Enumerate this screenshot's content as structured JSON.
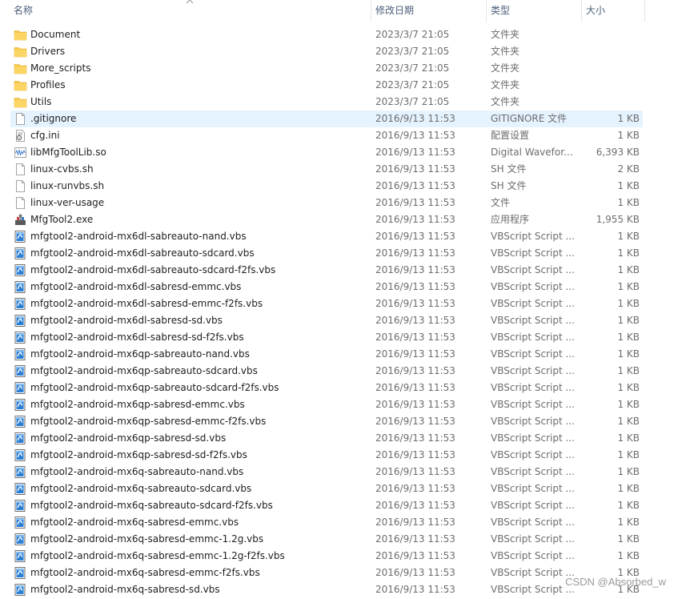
{
  "header": {
    "name": "名称",
    "date": "修改日期",
    "type": "类型",
    "size": "大小"
  },
  "rows": [
    {
      "icon": "folder-icon",
      "name": "Document",
      "date": "2023/3/7 21:05",
      "type": "文件夹",
      "size": ""
    },
    {
      "icon": "folder-icon",
      "name": "Drivers",
      "date": "2023/3/7 21:05",
      "type": "文件夹",
      "size": ""
    },
    {
      "icon": "folder-icon",
      "name": "More_scripts",
      "date": "2023/3/7 21:05",
      "type": "文件夹",
      "size": ""
    },
    {
      "icon": "folder-icon",
      "name": "Profiles",
      "date": "2023/3/7 21:05",
      "type": "文件夹",
      "size": ""
    },
    {
      "icon": "folder-icon",
      "name": "Utils",
      "date": "2023/3/7 21:05",
      "type": "文件夹",
      "size": ""
    },
    {
      "icon": "file-icon",
      "name": ".gitignore",
      "date": "2016/9/13 11:53",
      "type": "GITIGNORE 文件",
      "size": "1 KB",
      "selected": true
    },
    {
      "icon": "config-file-icon",
      "name": "cfg.ini",
      "date": "2016/9/13 11:53",
      "type": "配置设置",
      "size": "1 KB"
    },
    {
      "icon": "waveform-file-icon",
      "name": "libMfgToolLib.so",
      "date": "2016/9/13 11:53",
      "type": "Digital Wavefor...",
      "size": "6,393 KB"
    },
    {
      "icon": "file-icon",
      "name": "linux-cvbs.sh",
      "date": "2016/9/13 11:53",
      "type": "SH 文件",
      "size": "2 KB"
    },
    {
      "icon": "file-icon",
      "name": "linux-runvbs.sh",
      "date": "2016/9/13 11:53",
      "type": "SH 文件",
      "size": "1 KB"
    },
    {
      "icon": "file-icon",
      "name": "linux-ver-usage",
      "date": "2016/9/13 11:53",
      "type": "文件",
      "size": "1 KB"
    },
    {
      "icon": "app-exe-icon",
      "name": "MfgTool2.exe",
      "date": "2016/9/13 11:53",
      "type": "应用程序",
      "size": "1,955 KB"
    },
    {
      "icon": "vbs-script-icon",
      "name": "mfgtool2-android-mx6dl-sabreauto-nand.vbs",
      "date": "2016/9/13 11:53",
      "type": "VBScript Script ...",
      "size": "1 KB"
    },
    {
      "icon": "vbs-script-icon",
      "name": "mfgtool2-android-mx6dl-sabreauto-sdcard.vbs",
      "date": "2016/9/13 11:53",
      "type": "VBScript Script ...",
      "size": "1 KB"
    },
    {
      "icon": "vbs-script-icon",
      "name": "mfgtool2-android-mx6dl-sabreauto-sdcard-f2fs.vbs",
      "date": "2016/9/13 11:53",
      "type": "VBScript Script ...",
      "size": "1 KB"
    },
    {
      "icon": "vbs-script-icon",
      "name": "mfgtool2-android-mx6dl-sabresd-emmc.vbs",
      "date": "2016/9/13 11:53",
      "type": "VBScript Script ...",
      "size": "1 KB"
    },
    {
      "icon": "vbs-script-icon",
      "name": "mfgtool2-android-mx6dl-sabresd-emmc-f2fs.vbs",
      "date": "2016/9/13 11:53",
      "type": "VBScript Script ...",
      "size": "1 KB"
    },
    {
      "icon": "vbs-script-icon",
      "name": "mfgtool2-android-mx6dl-sabresd-sd.vbs",
      "date": "2016/9/13 11:53",
      "type": "VBScript Script ...",
      "size": "1 KB"
    },
    {
      "icon": "vbs-script-icon",
      "name": "mfgtool2-android-mx6dl-sabresd-sd-f2fs.vbs",
      "date": "2016/9/13 11:53",
      "type": "VBScript Script ...",
      "size": "1 KB"
    },
    {
      "icon": "vbs-script-icon",
      "name": "mfgtool2-android-mx6qp-sabreauto-nand.vbs",
      "date": "2016/9/13 11:53",
      "type": "VBScript Script ...",
      "size": "1 KB"
    },
    {
      "icon": "vbs-script-icon",
      "name": "mfgtool2-android-mx6qp-sabreauto-sdcard.vbs",
      "date": "2016/9/13 11:53",
      "type": "VBScript Script ...",
      "size": "1 KB"
    },
    {
      "icon": "vbs-script-icon",
      "name": "mfgtool2-android-mx6qp-sabreauto-sdcard-f2fs.vbs",
      "date": "2016/9/13 11:53",
      "type": "VBScript Script ...",
      "size": "1 KB"
    },
    {
      "icon": "vbs-script-icon",
      "name": "mfgtool2-android-mx6qp-sabresd-emmc.vbs",
      "date": "2016/9/13 11:53",
      "type": "VBScript Script ...",
      "size": "1 KB"
    },
    {
      "icon": "vbs-script-icon",
      "name": "mfgtool2-android-mx6qp-sabresd-emmc-f2fs.vbs",
      "date": "2016/9/13 11:53",
      "type": "VBScript Script ...",
      "size": "1 KB"
    },
    {
      "icon": "vbs-script-icon",
      "name": "mfgtool2-android-mx6qp-sabresd-sd.vbs",
      "date": "2016/9/13 11:53",
      "type": "VBScript Script ...",
      "size": "1 KB"
    },
    {
      "icon": "vbs-script-icon",
      "name": "mfgtool2-android-mx6qp-sabresd-sd-f2fs.vbs",
      "date": "2016/9/13 11:53",
      "type": "VBScript Script ...",
      "size": "1 KB"
    },
    {
      "icon": "vbs-script-icon",
      "name": "mfgtool2-android-mx6q-sabreauto-nand.vbs",
      "date": "2016/9/13 11:53",
      "type": "VBScript Script ...",
      "size": "1 KB"
    },
    {
      "icon": "vbs-script-icon",
      "name": "mfgtool2-android-mx6q-sabreauto-sdcard.vbs",
      "date": "2016/9/13 11:53",
      "type": "VBScript Script ...",
      "size": "1 KB"
    },
    {
      "icon": "vbs-script-icon",
      "name": "mfgtool2-android-mx6q-sabreauto-sdcard-f2fs.vbs",
      "date": "2016/9/13 11:53",
      "type": "VBScript Script ...",
      "size": "1 KB"
    },
    {
      "icon": "vbs-script-icon",
      "name": "mfgtool2-android-mx6q-sabresd-emmc.vbs",
      "date": "2016/9/13 11:53",
      "type": "VBScript Script ...",
      "size": "1 KB"
    },
    {
      "icon": "vbs-script-icon",
      "name": "mfgtool2-android-mx6q-sabresd-emmc-1.2g.vbs",
      "date": "2016/9/13 11:53",
      "type": "VBScript Script ...",
      "size": "1 KB"
    },
    {
      "icon": "vbs-script-icon",
      "name": "mfgtool2-android-mx6q-sabresd-emmc-1.2g-f2fs.vbs",
      "date": "2016/9/13 11:53",
      "type": "VBScript Script ...",
      "size": "1 KB"
    },
    {
      "icon": "vbs-script-icon",
      "name": "mfgtool2-android-mx6q-sabresd-emmc-f2fs.vbs",
      "date": "2016/9/13 11:53",
      "type": "VBScript Script ...",
      "size": "1 KB"
    },
    {
      "icon": "vbs-script-icon",
      "name": "mfgtool2-android-mx6q-sabresd-sd.vbs",
      "date": "2016/9/13 11:53",
      "type": "VBScript Script ...",
      "size": "1 KB"
    }
  ],
  "watermark": "CSDN @Absorbed_w",
  "colors": {
    "folder": "#f7c948",
    "selection": "#e5f3ff",
    "header_text": "#4c607a",
    "meta_text": "#6d6d6d"
  }
}
